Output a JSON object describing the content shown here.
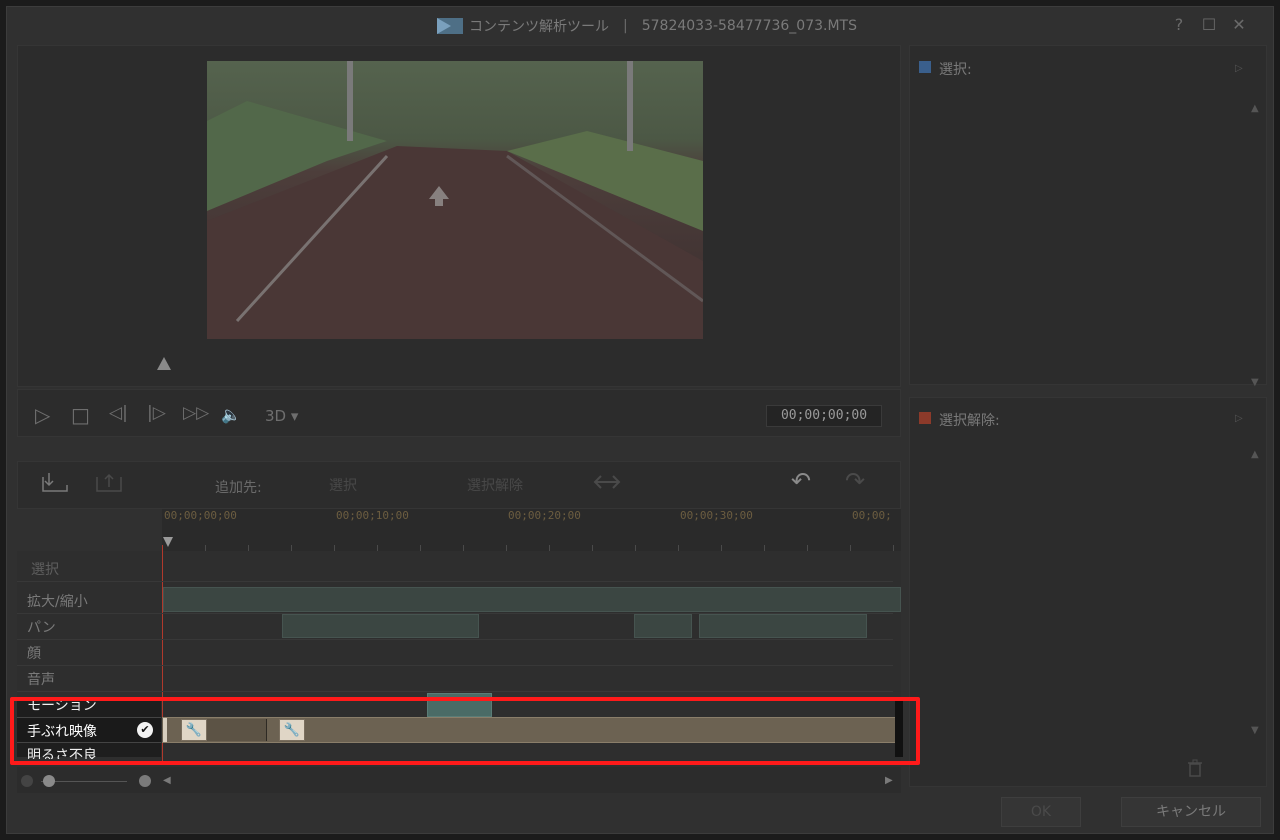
{
  "window": {
    "title": "コンテンツ解析ツール",
    "separator": "|",
    "filename": "57824033-58477736_073.MTS",
    "help": "?",
    "maximize": "☐",
    "close": "✕"
  },
  "player": {
    "controls": {
      "play": "▷",
      "stop": "□",
      "prev_frame": "◁|",
      "next_frame": "|▷",
      "fast_forward": "▷▷",
      "volume": "🔈"
    },
    "mode_3d": "3D ▾",
    "timecode": "00;00;00;00"
  },
  "toolbar": {
    "add_to_label": "追加先:",
    "select_button": "選択",
    "deselect_button": "選択解除",
    "undo": "↶",
    "redo": "↷"
  },
  "ruler": {
    "ticks": [
      "00;00;00;00",
      "00;00;10;00",
      "00;00;20;00",
      "00;00;30;00",
      "00;00;"
    ]
  },
  "tracks": {
    "select": "選択",
    "zoom": "拡大/縮小",
    "pan": "パン",
    "face": "顔",
    "audio": "音声",
    "motion": "モーション",
    "shaky": "手ぶれ映像",
    "brightness": "明るさ不良"
  },
  "shaky_check": "✔",
  "wrench_icon": "🔧",
  "right_panel": {
    "selected_label": "選択:",
    "selected_color": "#3a5f8c",
    "deselected_label": "選択解除:",
    "deselected_color": "#8c3a2a",
    "ok": "OK",
    "cancel": "キャンセル"
  },
  "colors": {
    "highlight": "#ff1a1a",
    "shaky_track": "#6c6252",
    "segment": "#3b4642"
  }
}
